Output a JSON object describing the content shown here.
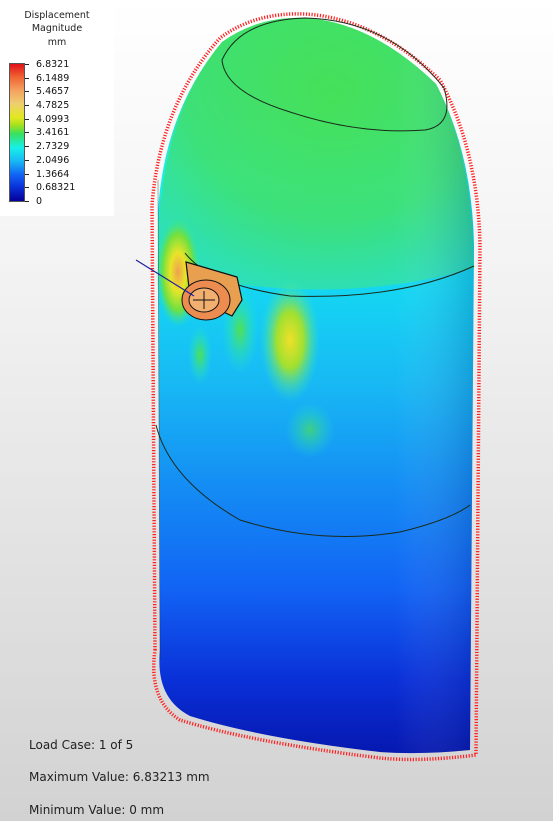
{
  "legend": {
    "title_line1": "Displacement",
    "title_line2": "Magnitude",
    "unit": "mm",
    "values": [
      "6.8321",
      "6.1489",
      "5.4657",
      "4.7825",
      "4.0993",
      "3.4161",
      "2.7329",
      "2.0496",
      "1.3664",
      "0.68321",
      "0"
    ]
  },
  "status": {
    "load_case": "Load Case:  1 of 5",
    "maximum": "Maximum Value: 6.83213 mm",
    "minimum": "Minimum Value: 0 mm"
  },
  "colors": {
    "max": "#e0101a",
    "mid": "#38e060",
    "min": "#050098",
    "deformed_outline": "#ff2020"
  }
}
